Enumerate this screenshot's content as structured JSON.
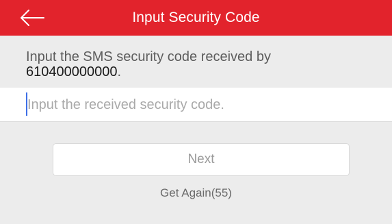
{
  "colors": {
    "header_background": "#e2232c",
    "page_background": "#ececec",
    "caret": "#3d6fe6"
  },
  "header": {
    "title": "Input Security Code",
    "back_icon": "arrow-left-icon"
  },
  "info": {
    "text": "Input the SMS security code received by",
    "phone": "610400000000",
    "suffix": "."
  },
  "code_input": {
    "placeholder": "Input the received security code.",
    "value": ""
  },
  "actions": {
    "next_label": "Next",
    "get_again_label": "Get Again(55)"
  }
}
